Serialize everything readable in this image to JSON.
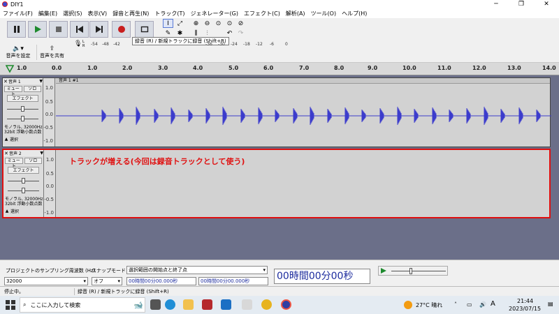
{
  "window": {
    "title": "DIY1",
    "controls": [
      "─",
      "❐",
      "✕"
    ]
  },
  "menu": [
    "ファイル(F)",
    "編集(E)",
    "選択(S)",
    "表示(V)",
    "録音と再生(N)",
    "トラック(T)",
    "ジェネレーター(G)",
    "エフェクト(C)",
    "解析(A)",
    "ツール(O)",
    "ヘルプ(H)"
  ],
  "toolbar": {
    "audio_setup_label": "音声を設定",
    "share_label": "音声を共有",
    "tooltip": "録音 (R) / 新規トラックに録音 (Shift+R)",
    "meter_ticks": [
      "-54",
      "-48",
      "-42",
      "-36",
      "-30",
      "-24",
      "-18",
      "-12",
      "-6",
      "0"
    ],
    "meter_label_R": "R",
    "meter_label_L": "L"
  },
  "ruler": {
    "ticks": [
      "1.0",
      "0.0",
      "1.0",
      "2.0",
      "3.0",
      "4.0",
      "5.0",
      "6.0",
      "7.0",
      "8.0",
      "9.0",
      "10.0",
      "11.0",
      "12.0",
      "13.0",
      "14.0"
    ]
  },
  "tracks": [
    {
      "name": "音声 1",
      "clip_name": "音声 1 #1",
      "mute": "ミュート",
      "solo": "ソロ",
      "effect": "エフェクト",
      "info_line1": "モノラル, 32000Hz",
      "info_line2": "32bit 浮動小数点数",
      "select": "選択",
      "scale": [
        "1.0",
        "0.5",
        "0.0",
        "-0.5",
        "-1.0"
      ]
    },
    {
      "name": "音声 2",
      "mute": "ミュート",
      "solo": "ソロ",
      "effect": "エフェクト",
      "info_line1": "モノラル, 32000Hz",
      "info_line2": "32bit 浮動小数点数",
      "select": "選択",
      "scale": [
        "1.0",
        "0.5",
        "0.0",
        "-0.5",
        "-1.0"
      ],
      "annotation": "トラックが増える(今回は録音トラックとして使う)"
    }
  ],
  "selection": {
    "rate_label": "プロジェクトのサンプリング周波数 (Hz)",
    "rate_value": "32000",
    "snap_label": "スナップモード",
    "snap_value": "オフ",
    "sel_mode": "選択範囲の開始点と終了点",
    "start_time": "00時間00分00.000秒",
    "end_time": "00時間00分00.000秒",
    "big_time": "00時間00分00秒"
  },
  "status": {
    "state": "停止中。",
    "message": "録音 (R) / 新規トラックに録音 (Shift+R)"
  },
  "taskbar": {
    "search_placeholder": "ここに入力して検索",
    "weather": "27°C 晴れ",
    "ime": "A",
    "time": "21:44",
    "date": "2023/07/15"
  },
  "colors": {
    "waveform": "#3c3ccc",
    "annotation": "#e01010",
    "track_bg": "#d2d2d2",
    "project_bg": "#6b6f89"
  }
}
